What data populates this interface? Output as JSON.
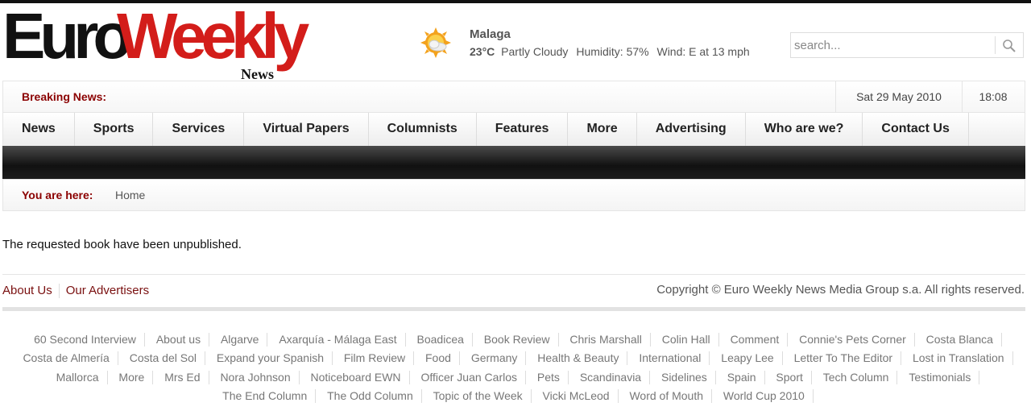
{
  "brand": {
    "part1": "Euro",
    "part2": "Weekly",
    "part3": "News"
  },
  "weather": {
    "icon": "partly-cloudy-icon",
    "city": "Malaga",
    "temp": "23°C",
    "condition": "Partly Cloudy",
    "humidity": "Humidity: 57%",
    "wind": "Wind: E at 13 mph"
  },
  "search": {
    "placeholder": "search...",
    "icon": "search-icon"
  },
  "breaking": {
    "label": "Breaking News:",
    "date": "Sat 29 May 2010",
    "time": "18:08"
  },
  "nav": [
    "News",
    "Sports",
    "Services",
    "Virtual Papers",
    "Columnists",
    "Features",
    "More",
    "Advertising",
    "Who are we?",
    "Contact Us"
  ],
  "breadcrumb": {
    "label": "You are here:",
    "home": "Home"
  },
  "main": {
    "message": "The requested book have been unpublished."
  },
  "footer": {
    "links": [
      "About Us",
      "Our Advertisers"
    ],
    "copyright": "Copyright © Euro Weekly News Media Group s.a. All rights reserved."
  },
  "tags": [
    "60 Second Interview",
    "About us",
    "Algarve",
    "Axarquía - Málaga East",
    "Boadicea",
    "Book Review",
    "Chris Marshall",
    "Colin Hall",
    "Comment",
    "Connie's Pets Corner",
    "Costa Blanca",
    "Costa de Almería",
    "Costa del Sol",
    "Expand your Spanish",
    "Film Review",
    "Food",
    "Germany",
    "Health & Beauty",
    "International",
    "Leapy Lee",
    "Letter To The Editor",
    "Lost in Translation",
    "Mallorca",
    "More",
    "Mrs Ed",
    "Nora Johnson",
    "Noticeboard EWN",
    "Officer Juan Carlos",
    "Pets",
    "Scandinavia",
    "Sidelines",
    "Spain",
    "Sport",
    "Tech Column",
    "Testimonials",
    "The End Column",
    "The Odd Column",
    "Topic of the Week",
    "Vicki McLeod",
    "Word of Mouth",
    "World Cup 2010"
  ]
}
